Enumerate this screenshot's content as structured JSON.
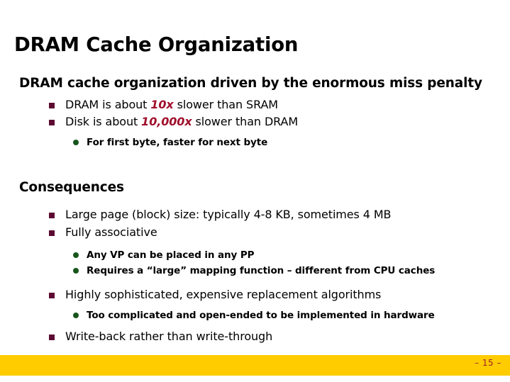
{
  "slide": {
    "title": "DRAM Cache Organization",
    "sections": [
      {
        "heading": "DRAM cache organization driven by the enormous miss penalty",
        "items": [
          {
            "level": 2,
            "bullet": "square-bullet-maroon",
            "prefix": "DRAM is about ",
            "emphasis": "10x",
            "suffix": " slower than SRAM"
          },
          {
            "level": 2,
            "bullet": "square-bullet-maroon",
            "prefix": "Disk is about ",
            "emphasis": "10,000x",
            "suffix": " slower than DRAM"
          },
          {
            "level": 3,
            "bullet": "round-bullet-green",
            "text": "For first byte, faster for next byte"
          }
        ]
      },
      {
        "heading": "Consequences",
        "items": [
          {
            "level": 2,
            "bullet": "square-bullet-maroon",
            "text": "Large page (block) size: typically 4-8 KB, sometimes 4 MB"
          },
          {
            "level": 2,
            "bullet": "square-bullet-maroon",
            "text": "Fully associative"
          },
          {
            "level": 3,
            "bullet": "round-bullet-green",
            "text": "Any VP can be placed in any PP"
          },
          {
            "level": 3,
            "bullet": "round-bullet-green",
            "text": "Requires a “large” mapping function – different from CPU caches"
          },
          {
            "level": 2,
            "bullet": "square-bullet-maroon",
            "text": "Highly sophisticated, expensive replacement algorithms"
          },
          {
            "level": 3,
            "bullet": "round-bullet-green",
            "text": "Too complicated and open-ended to be implemented in hardware"
          },
          {
            "level": 2,
            "bullet": "square-bullet-maroon",
            "text": "Write-back rather than write-through"
          }
        ]
      }
    ]
  },
  "footer": {
    "page_number": "– 15 –",
    "bar_color": "#FFCC00",
    "page_number_color": "#A0202A"
  },
  "colors": {
    "square_bullet": "#5C0A32",
    "round_bullet": "#17561C",
    "emphasis_text": "#A00F2B",
    "body_text": "#000000",
    "background": "#FFFFFF"
  }
}
